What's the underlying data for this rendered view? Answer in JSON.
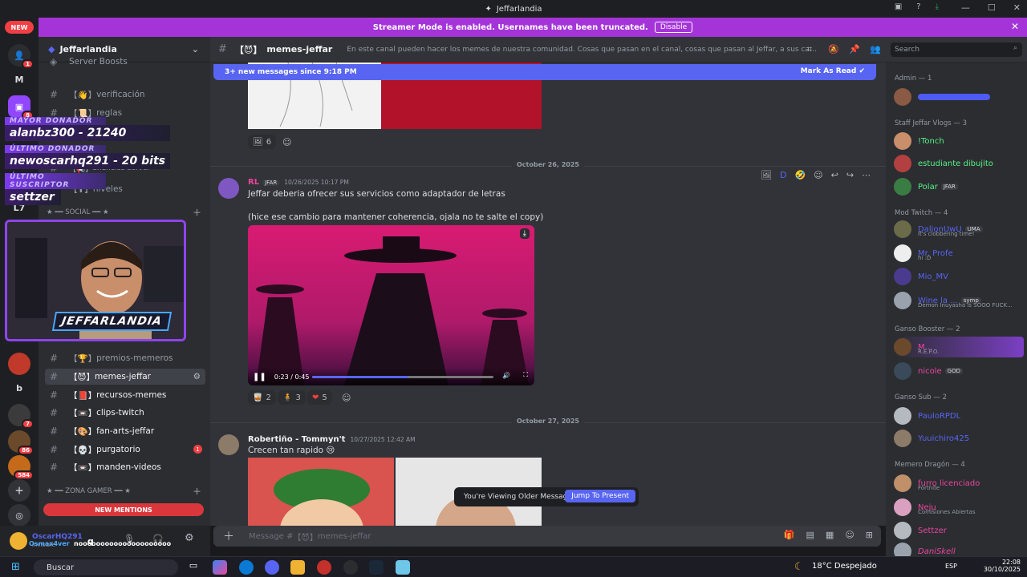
{
  "window": {
    "title": "Jeffarlandia"
  },
  "banner": {
    "text": "Streamer Mode is enabled. Usernames have been truncated.",
    "disable_label": "Disable"
  },
  "server_list": {
    "new_label": "NEW",
    "items": [
      {
        "label": "",
        "badge": "1"
      },
      {
        "label": "M",
        "badge": ""
      },
      {
        "label": "",
        "badge": "8"
      },
      {
        "label": "L7",
        "badge": ""
      },
      {
        "label": "b",
        "badge": ""
      },
      {
        "label": "",
        "badge": "7"
      },
      {
        "label": "",
        "badge": "86"
      },
      {
        "label": "",
        "badge": "584"
      }
    ]
  },
  "sidebar": {
    "guild_name": "Jeffarlandia",
    "server_boosts": "Server Boosts",
    "channels_top": [
      {
        "label": "verificación",
        "prefix": "【👋】"
      },
      {
        "label": "reglas",
        "prefix": "【📜】"
      },
      {
        "label": "anuncios-server",
        "prefix": "【📢】"
      },
      {
        "label": "niveles",
        "prefix": "【⬆】"
      }
    ],
    "social_category": "★ ━━ SOCIAL ━━ ★",
    "premios_channel": "premios-memeros",
    "channels_bottom": [
      {
        "label": "memes-jeffar",
        "prefix": "【😈】",
        "active": true,
        "unread": ""
      },
      {
        "label": "recursos-memes",
        "prefix": "【📕】",
        "active": false,
        "unread": ""
      },
      {
        "label": "clips-twitch",
        "prefix": "【📼】",
        "active": false,
        "unread": ""
      },
      {
        "label": "fan-arts-jeffar",
        "prefix": "【🎨】",
        "active": false,
        "unread": ""
      },
      {
        "label": "purgatorio",
        "prefix": "【💀】",
        "active": false,
        "unread": "1"
      },
      {
        "label": "manden-videos",
        "prefix": "【📼】",
        "active": false,
        "unread": ""
      }
    ],
    "gamer_category": "★ ━━ ZONA GAMER ━━ ★",
    "new_mentions": "NEW MENTIONS"
  },
  "overlay": {
    "mayor_label": "MAYOR DONADOR",
    "mayor_value": "alanbz300 - 21240",
    "ultimo_label": "ÚLTIMO DONADOR",
    "ultimo_value": "newoscarhq291 - 20 bits",
    "sub_label": "ÚLTIMO SUSCRIPTOR",
    "sub_value": "settzer",
    "webcam_logo": "JEFFARLANDIA"
  },
  "user_panel": {
    "name": "OscarHQ291",
    "status": "Invisible",
    "typing": "q",
    "chat_line": "nooooooooooooooooooooo",
    "overlay_user": "Osmax4ver"
  },
  "header": {
    "channel": "memes-jeffar",
    "channel_prefix": "【😈】",
    "topic": "En este canal pueden hacer los memes de nuestra comunidad. Cosas que pasan en el canal, cosas que pasan al Jeffar, a sus canales, en stream o ...",
    "search_placeholder": "Search"
  },
  "new_messages_bar": {
    "text": "3+ new messages since 9:18 PM",
    "mark_label": "Mark As Read"
  },
  "messages": [
    {
      "reaction_count": "6"
    },
    {
      "date": "October 26, 2025",
      "author": "RL",
      "tag": "JFAR",
      "timestamp": "10/26/2025 10:17 PM",
      "line1": "Jeffar deberia ofrecer sus servicios como adaptador de letras",
      "line2": "(hice ese cambio para mantener coherencia, ojala no te salte el copy)",
      "video_time": "0:23 / 0:45",
      "progress": 0.53,
      "reactions": [
        {
          "emoji": "🥃",
          "count": "2"
        },
        {
          "emoji": "🧍",
          "count": "3"
        },
        {
          "emoji": "❤",
          "count": "5"
        }
      ]
    },
    {
      "date": "October 27, 2025",
      "author": "Robertiño - Tommyn't",
      "timestamp": "10/27/2025 12:42 AM",
      "text": "Crecen tan rapido 😢"
    }
  ],
  "older_bar": {
    "text": "You're Viewing Older Messages",
    "jump_label": "Jump To Present"
  },
  "composer": {
    "placeholder_prefix": "Message #",
    "channel_prefix": "【😈】",
    "channel": "memes-jeffar"
  },
  "members": [
    {
      "category": "Admin — 1",
      "items": [
        {
          "name": "",
          "color": "#4e5bf2",
          "sub": "",
          "tag": ""
        }
      ]
    },
    {
      "category": "Staff Jeffar Vlogs — 3",
      "items": [
        {
          "name": "!Tonch",
          "color": "#57f287",
          "sub": "",
          "tag": ""
        },
        {
          "name": "estudiante dibujito",
          "color": "#57f287",
          "sub": "",
          "tag": ""
        },
        {
          "name": "Polar",
          "color": "#57f287",
          "sub": "",
          "tag": "JFAR"
        }
      ]
    },
    {
      "category": "Mod Twitch — 4",
      "items": [
        {
          "name": "DalionUwU",
          "color": "#5865f2",
          "sub": "It's clobbering time!",
          "tag": "UMA"
        },
        {
          "name": "Mr. Profe",
          "color": "#5865f2",
          "sub": "hi :D",
          "tag": ""
        },
        {
          "name": "Mio_MV",
          "color": "#5865f2",
          "sub": "",
          "tag": ""
        },
        {
          "name": "Wine la ...",
          "color": "#5865f2",
          "sub": "Demon Inuyasha is SOOO FUCK...",
          "tag": "symp"
        }
      ]
    },
    {
      "category": "Ganso Booster — 2",
      "items": [
        {
          "name": "M...",
          "color": "#eb459e",
          "sub": "R.E.P.O.",
          "tag": ""
        },
        {
          "name": "nicole",
          "color": "#eb459e",
          "sub": "",
          "tag": "GOD"
        }
      ]
    },
    {
      "category": "Ganso Sub — 2",
      "items": [
        {
          "name": "PauloRPDL",
          "color": "#5865f2",
          "sub": "",
          "tag": ""
        },
        {
          "name": "Yuuichiro425",
          "color": "#5865f2",
          "sub": "",
          "tag": ""
        }
      ]
    },
    {
      "category": "Memero Dragón — 4",
      "items": [
        {
          "name": "furro licenciado",
          "color": "#eb459e",
          "sub": "Fortnite",
          "tag": ""
        },
        {
          "name": "Neju",
          "color": "#eb459e",
          "sub": "Comisiones Abiertas",
          "tag": ""
        },
        {
          "name": "Settzer",
          "color": "#eb459e",
          "sub": "",
          "tag": ""
        },
        {
          "name": "DaniSkell",
          "color": "#eb459e",
          "sub": "",
          "tag": ""
        }
      ]
    }
  ],
  "taskbar": {
    "search_label": "Buscar",
    "weather": "18°C  Despejado",
    "lang": "ESP",
    "time": "22:08",
    "date": "30/10/2025"
  }
}
